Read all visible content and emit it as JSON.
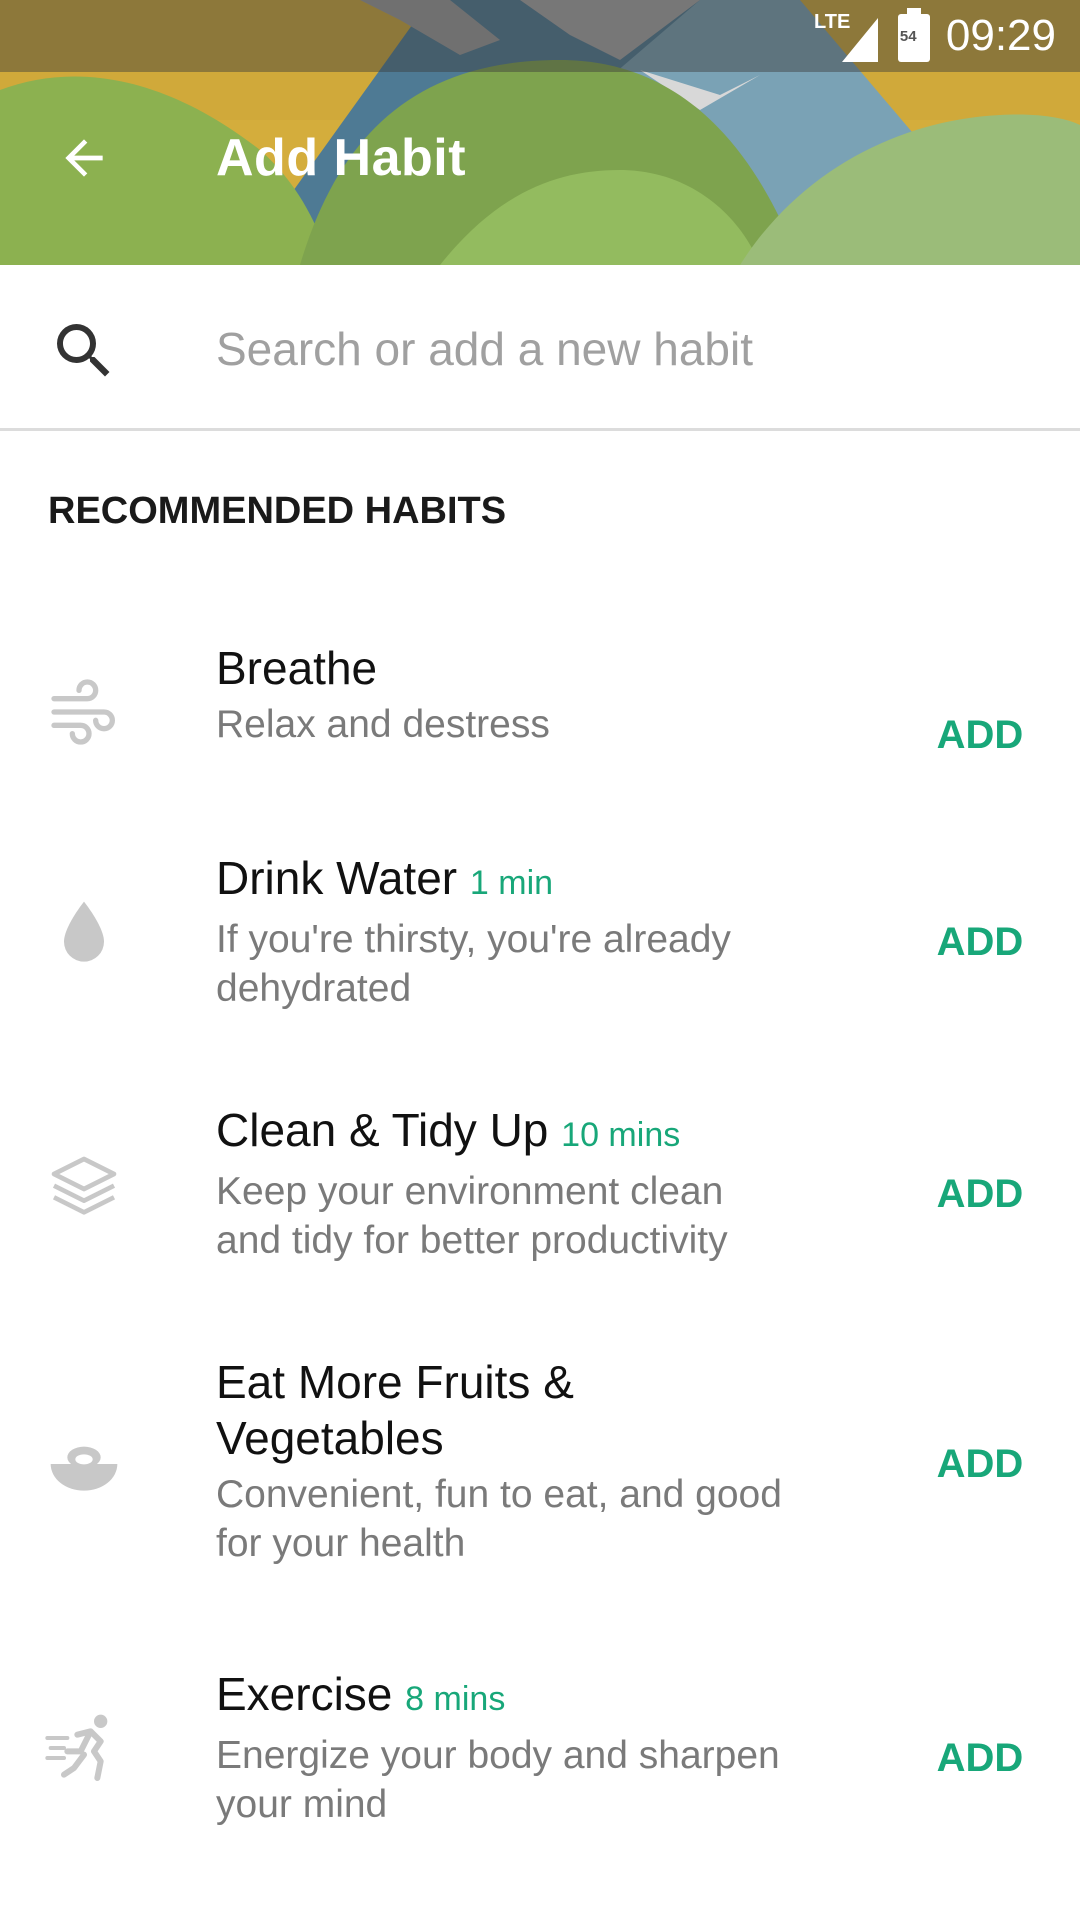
{
  "status_bar": {
    "network": "LTE",
    "battery": "54",
    "time": "09:29"
  },
  "toolbar": {
    "title": "Add Habit"
  },
  "search": {
    "placeholder": "Search or add a new habit"
  },
  "section": {
    "heading": "RECOMMENDED HABITS"
  },
  "habits": [
    {
      "title": "Breathe",
      "duration": "",
      "description": "Relax and destress",
      "action": "ADD",
      "icon": "wind-icon"
    },
    {
      "title": "Drink Water",
      "duration": "1 min",
      "description": "If you're thirsty, you're already dehydrated",
      "action": "ADD",
      "icon": "water-drop-icon"
    },
    {
      "title": "Clean & Tidy Up",
      "duration": "10 mins",
      "description": "Keep your environment clean and tidy for better productivity",
      "action": "ADD",
      "icon": "stack-layers-icon"
    },
    {
      "title": "Eat More Fruits & Vegetables",
      "duration": "",
      "description": "Convenient, fun to eat, and good for your health",
      "action": "ADD",
      "icon": "salad-bowl-icon"
    },
    {
      "title": "Exercise",
      "duration": "8 mins",
      "description": "Energize your body and sharpen your mind",
      "action": "ADD",
      "icon": "running-person-icon"
    }
  ],
  "colors": {
    "accent": "#18a779",
    "icon_gray": "#c8c8c8"
  }
}
